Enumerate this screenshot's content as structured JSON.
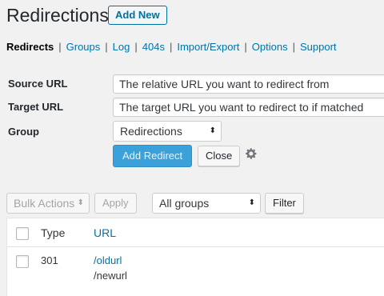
{
  "page": {
    "title": "Redirections",
    "add_new": "Add New"
  },
  "subnav": {
    "current": "Redirects",
    "links": [
      "Groups",
      "Log",
      "404s",
      "Import/Export",
      "Options",
      "Support"
    ],
    "separator": "|"
  },
  "form": {
    "source_label": "Source URL",
    "source_placeholder": "The relative URL you want to redirect from",
    "target_label": "Target URL",
    "target_placeholder": "The target URL you want to redirect to if matched",
    "group_label": "Group",
    "group_value": "Redirections",
    "add_button": "Add Redirect",
    "close_button": "Close"
  },
  "toolbar": {
    "bulk_actions": "Bulk Actions",
    "apply": "Apply",
    "group_filter": "All groups",
    "filter": "Filter"
  },
  "table": {
    "headers": {
      "type": "Type",
      "url": "URL"
    },
    "rows": [
      {
        "type": "301",
        "source": "/oldurl",
        "target": "/newurl"
      }
    ]
  },
  "icons": {
    "select_arrows": "⬍",
    "gear": "gear-icon"
  },
  "colors": {
    "accent": "#0073aa",
    "primary_button": "#3ba1da",
    "background": "#f1f1f1"
  }
}
